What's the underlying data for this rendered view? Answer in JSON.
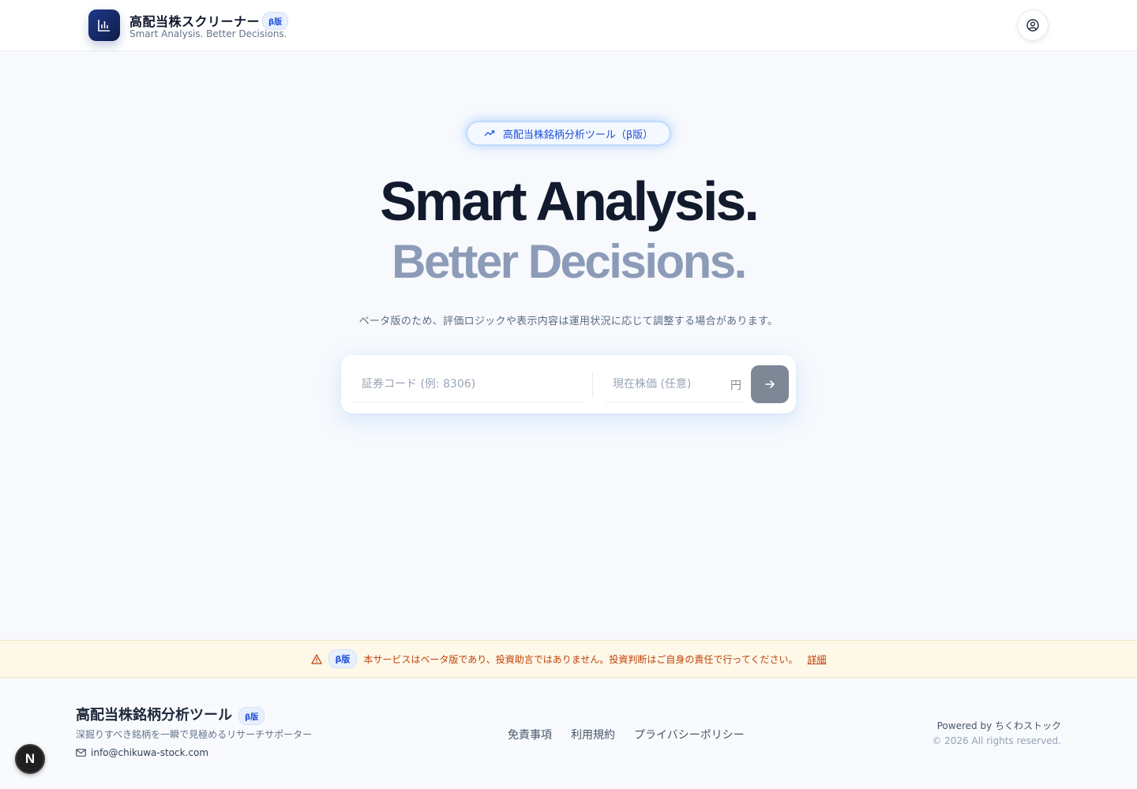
{
  "header": {
    "title": "高配当株スクリーナー",
    "beta": "β版",
    "subtitle": "Smart Analysis. Better Decisions.",
    "account_icon": "user-circle-icon",
    "logo_icon": "bar-chart-icon"
  },
  "hero": {
    "pill_label": "高配当株銘柄分析ツール（β版）",
    "pill_icon": "trending-up-icon",
    "headline_1": "Smart Analysis.",
    "headline_2": "Better Decisions.",
    "note": "ベータ版のため、評価ロジックや表示内容は運用状況に応じて調整する場合があります。"
  },
  "search": {
    "code_placeholder": "証券コード (例: 8306)",
    "price_placeholder": "現在株価 (任意)",
    "price_unit": "円",
    "submit_icon": "arrow-right-icon"
  },
  "notice": {
    "icon": "warning-icon",
    "beta": "β版",
    "text": "本サービスはベータ版であり、投資助言ではありません。投資判断はご自身の責任で行ってください。",
    "link": "詳細"
  },
  "footer": {
    "title": "高配当株銘柄分析ツール",
    "beta": "β版",
    "tagline": "深掘りすべき銘柄を一瞬で見極めるリサーチサポーター",
    "email": "info@chikuwa-stock.com",
    "links": [
      "免責事項",
      "利用規約",
      "プライバシーポリシー"
    ],
    "powered": "Powered by ちくわストック",
    "copyright": "© 2026 All rights reserved."
  },
  "dev_badge": "N",
  "colors": {
    "brand": "#1e3a8a",
    "accent": "#1d4ed8",
    "notice_text": "#c2410c",
    "notice_bg": "#fdf8e8"
  }
}
